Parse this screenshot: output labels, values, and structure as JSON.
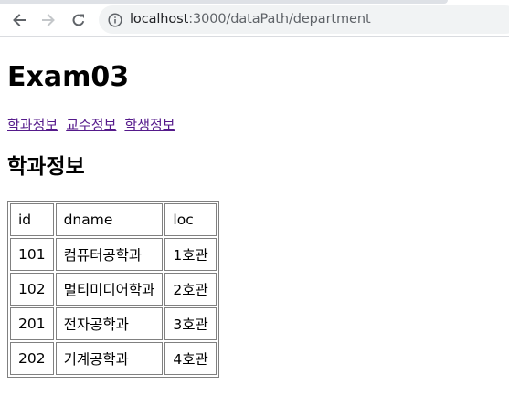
{
  "browser": {
    "url_host": "localhost",
    "url_path": ":3000/dataPath/department"
  },
  "page": {
    "title": "Exam03",
    "links": [
      "학과정보",
      "교수정보",
      "학생정보"
    ],
    "section_title": "학과정보",
    "table": {
      "headers": [
        "id",
        "dname",
        "loc"
      ],
      "rows": [
        [
          "101",
          "컴퓨터공학과",
          "1호관"
        ],
        [
          "102",
          "멀티미디어학과",
          "2호관"
        ],
        [
          "201",
          "전자공학과",
          "3호관"
        ],
        [
          "202",
          "기계공학과",
          "4호관"
        ]
      ]
    }
  }
}
